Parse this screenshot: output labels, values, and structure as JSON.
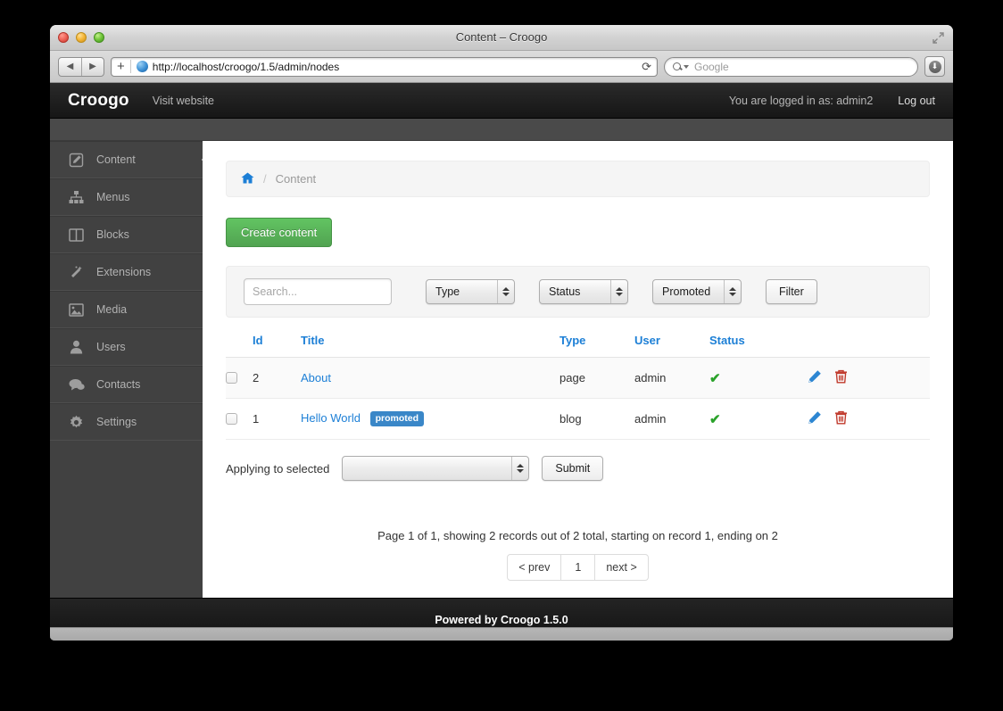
{
  "window": {
    "title": "Content – Croogo",
    "traffic_lights": [
      "close",
      "minimize",
      "zoom"
    ]
  },
  "browser": {
    "back_glyph": "◀",
    "forward_glyph": "▶",
    "new_tab_glyph": "+",
    "url": "http://localhost/croogo/1.5/admin/nodes",
    "reload_glyph": "⟳",
    "search_placeholder": "Google",
    "downloads_glyph": "⬇"
  },
  "topbar": {
    "brand": "Croogo",
    "visit_website": "Visit website",
    "logged_in_as": "You are logged in as: admin2",
    "log_out": "Log out"
  },
  "sidebar": {
    "items": [
      {
        "label": "Content",
        "icon": "pencil-square-icon",
        "glyph": "✎",
        "active": true
      },
      {
        "label": "Menus",
        "icon": "sitemap-icon",
        "glyph": "⛬",
        "active": false
      },
      {
        "label": "Blocks",
        "icon": "columns-icon",
        "glyph": "▥",
        "active": false
      },
      {
        "label": "Extensions",
        "icon": "magic-wand-icon",
        "glyph": "✦",
        "active": false
      },
      {
        "label": "Media",
        "icon": "image-icon",
        "glyph": "▣",
        "active": false
      },
      {
        "label": "Users",
        "icon": "user-icon",
        "glyph": "👤",
        "active": false
      },
      {
        "label": "Contacts",
        "icon": "comments-icon",
        "glyph": "💬",
        "active": false
      },
      {
        "label": "Settings",
        "icon": "gear-icon",
        "glyph": "⚙",
        "active": false
      }
    ]
  },
  "breadcrumb": {
    "home_icon": "home-icon",
    "separator": "/",
    "current": "Content"
  },
  "actions": {
    "create_content": "Create content"
  },
  "filter_bar": {
    "search_placeholder": "Search...",
    "search_value": "",
    "type_select": "Type",
    "status_select": "Status",
    "promoted_select": "Promoted",
    "filter_button": "Filter"
  },
  "table": {
    "columns": [
      "",
      "Id",
      "Title",
      "Type",
      "User",
      "Status",
      ""
    ],
    "rows": [
      {
        "checked": false,
        "id": "2",
        "title": "About",
        "badge": "",
        "type": "page",
        "user": "admin",
        "status_icon": "check-icon",
        "status_glyph": "✔",
        "edit_icon": "pencil-icon",
        "delete_icon": "trash-icon"
      },
      {
        "checked": false,
        "id": "1",
        "title": "Hello World",
        "badge": "promoted",
        "type": "blog",
        "user": "admin",
        "status_icon": "check-icon",
        "status_glyph": "✔",
        "edit_icon": "pencil-icon",
        "delete_icon": "trash-icon"
      }
    ]
  },
  "bulk": {
    "label": "Applying to selected",
    "select_value": "",
    "submit": "Submit"
  },
  "pagination": {
    "info": "Page 1 of 1, showing 2 records out of 2 total, starting on record 1, ending on 2",
    "prev": "< prev",
    "current": "1",
    "next": "next >"
  },
  "footer": {
    "text": "Powered by Croogo 1.5.0"
  },
  "colors": {
    "accent_blue": "#1c7fd6",
    "badge_blue": "#3a87c8",
    "success_green": "#2aa22a",
    "create_green": "#51a351",
    "delete_red": "#c0392b",
    "sidebar_bg": "#414141",
    "topbar_bg": "#1b1b1b"
  }
}
